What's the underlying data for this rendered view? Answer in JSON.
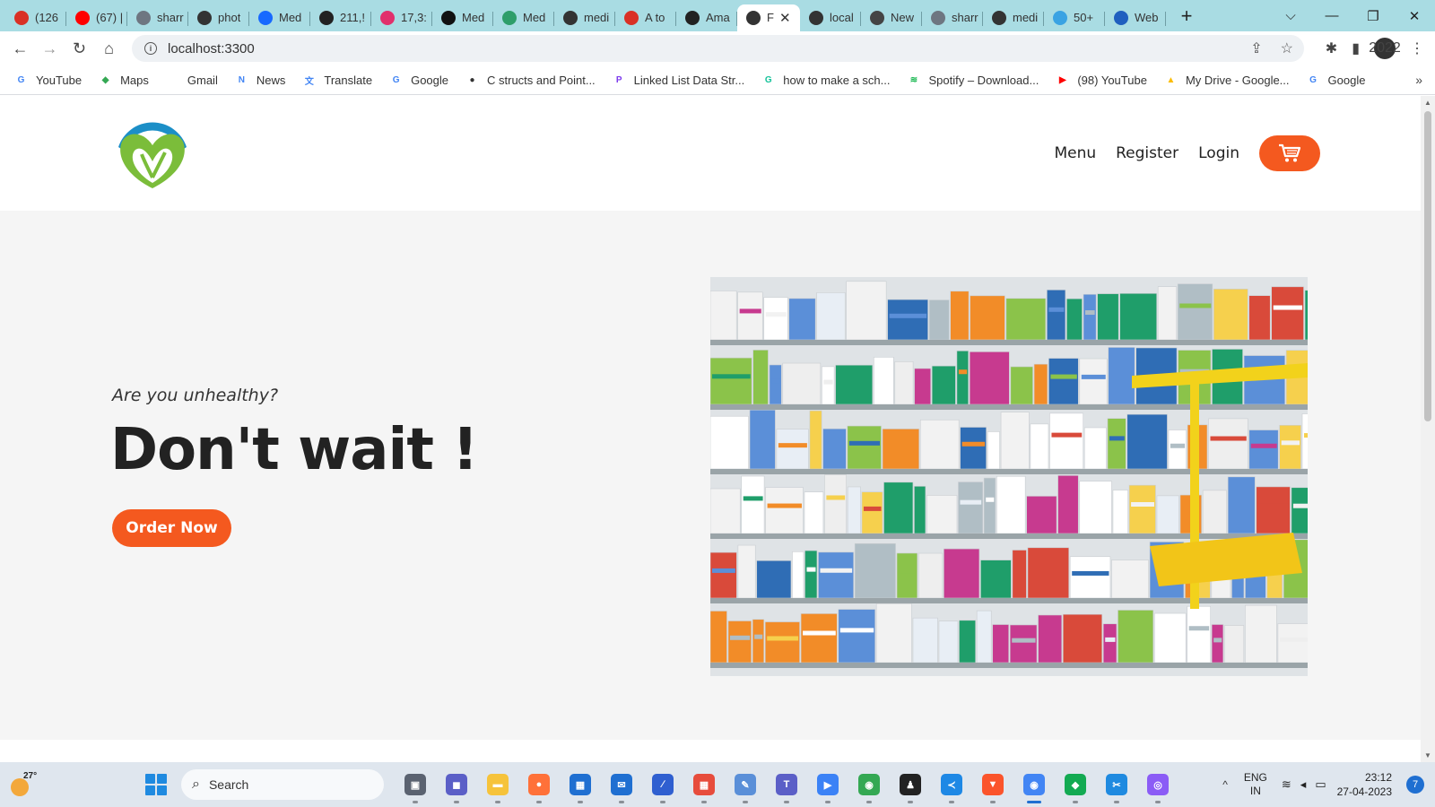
{
  "browser": {
    "tabs": [
      {
        "title": "(126",
        "icon": "gmail-icon",
        "color": "#d93025"
      },
      {
        "title": "(67) |",
        "icon": "youtube-icon",
        "color": "#ff0000"
      },
      {
        "title": "sharr",
        "icon": "github-icon",
        "color": "#6e7681"
      },
      {
        "title": "phot",
        "icon": "globe-icon",
        "color": "#333333"
      },
      {
        "title": "Med",
        "icon": "behance-icon",
        "color": "#1769ff"
      },
      {
        "title": "211,!",
        "icon": "shutterstock-icon",
        "color": "#222222"
      },
      {
        "title": "17,3:",
        "icon": "instagram-icon",
        "color": "#e1306c"
      },
      {
        "title": "Med",
        "icon": "stocksy-icon",
        "color": "#111111"
      },
      {
        "title": "Med",
        "icon": "document-icon",
        "color": "#2e9e6a"
      },
      {
        "title": "medi",
        "icon": "globe-icon",
        "color": "#333333"
      },
      {
        "title": "A to",
        "icon": "scribd-icon",
        "color": "#d93025"
      },
      {
        "title": "Ama",
        "icon": "amazon-icon",
        "color": "#222222"
      },
      {
        "title": "F",
        "icon": "globe-icon",
        "color": "#333333",
        "active": true
      },
      {
        "title": "local",
        "icon": "globe-icon",
        "color": "#333333"
      },
      {
        "title": "New",
        "icon": "chrome-icon",
        "color": "#444444"
      },
      {
        "title": "sharr",
        "icon": "github-icon",
        "color": "#6e7681"
      },
      {
        "title": "medi",
        "icon": "globe-icon",
        "color": "#333333"
      },
      {
        "title": "50+",
        "icon": "vectorgrove-icon",
        "color": "#3aa3e3"
      },
      {
        "title": "Web",
        "icon": "md-icon",
        "color": "#1f5fbf"
      }
    ],
    "new_tab": "+",
    "window_controls": {
      "dropdown": "⌵",
      "minimize": "—",
      "restore": "❐",
      "close": "✕"
    },
    "tab_close": "✕",
    "url": "localhost:3300",
    "nav": {
      "back": "←",
      "forward": "→",
      "reload": "↻",
      "home": "⌂"
    },
    "omnibox_icons": {
      "share": "⇪",
      "star": "☆"
    },
    "toolbar_icons": {
      "extensions": "✱",
      "sidepanel": "▮",
      "menu": "⋮"
    },
    "profile_label": "2022",
    "bookmarks": [
      {
        "label": "YouTube",
        "icon": "google-icon",
        "color": "#4285f4",
        "glyph": "G"
      },
      {
        "label": "Maps",
        "icon": "maps-icon",
        "color": "#34a853",
        "glyph": "◆"
      },
      {
        "label": "Gmail",
        "icon": "gmail-icon",
        "color": "#ffffff",
        "glyph": ""
      },
      {
        "label": "News",
        "icon": "news-icon",
        "color": "#4285f4",
        "glyph": "N"
      },
      {
        "label": "Translate",
        "icon": "translate-icon",
        "color": "#4285f4",
        "glyph": "文"
      },
      {
        "label": "Google",
        "icon": "google-icon",
        "color": "#4285f4",
        "glyph": "G"
      },
      {
        "label": "C structs and Point...",
        "icon": "globe-icon",
        "color": "#333333",
        "glyph": "●"
      },
      {
        "label": "Linked List Data Str...",
        "icon": "programiz-icon",
        "color": "#7c3aed",
        "glyph": "P"
      },
      {
        "label": "how to make a sch...",
        "icon": "grammarly-icon",
        "color": "#15c39a",
        "glyph": "G"
      },
      {
        "label": "Spotify – Download...",
        "icon": "spotify-icon",
        "color": "#1db954",
        "glyph": "≋"
      },
      {
        "label": "(98) YouTube",
        "icon": "youtube-icon",
        "color": "#ff0000",
        "glyph": "▶"
      },
      {
        "label": "My Drive - Google...",
        "icon": "drive-icon",
        "color": "#fbbc04",
        "glyph": "▲"
      },
      {
        "label": "Google",
        "icon": "google-icon",
        "color": "#4285f4",
        "glyph": "G"
      }
    ],
    "bookmarks_more": "»"
  },
  "site": {
    "nav": {
      "menu": "Menu",
      "register": "Register",
      "login": "Login"
    },
    "tagline": "Are you unhealthy?",
    "headline": "Don't wait !",
    "cta": "Order Now",
    "accent": "#f4591f",
    "logo_green": "#7bbd3a",
    "logo_blue": "#1c8fc7"
  },
  "taskbar": {
    "temperature": "27°",
    "search_label": "Search",
    "apps": [
      {
        "name": "task-view-icon",
        "color": "#5a6270",
        "glyph": "▣"
      },
      {
        "name": "meet-icon",
        "color": "#5b5fc7",
        "glyph": "◼"
      },
      {
        "name": "file-explorer-icon",
        "color": "#f6c33b",
        "glyph": "▬"
      },
      {
        "name": "firefox-icon",
        "color": "#ff7139",
        "glyph": "●"
      },
      {
        "name": "store-icon",
        "color": "#1f6fd1",
        "glyph": "▦"
      },
      {
        "name": "mail-icon",
        "color": "#1f6fd1",
        "glyph": "✉"
      },
      {
        "name": "mathpix-icon",
        "color": "#2f5fd0",
        "glyph": "∕"
      },
      {
        "name": "office-icon",
        "color": "#e74c3c",
        "glyph": "▦"
      },
      {
        "name": "notepad-icon",
        "color": "#5a8fd8",
        "glyph": "✎"
      },
      {
        "name": "teams-icon",
        "color": "#5b5fc7",
        "glyph": "T"
      },
      {
        "name": "power-automate-icon",
        "color": "#3b82f6",
        "glyph": "▶"
      },
      {
        "name": "chrome-icon",
        "color": "#34a853",
        "glyph": "◉"
      },
      {
        "name": "linux-icon",
        "color": "#222222",
        "glyph": "♟"
      },
      {
        "name": "vscode-icon",
        "color": "#1e88e5",
        "glyph": "≺"
      },
      {
        "name": "brave-icon",
        "color": "#fb542b",
        "glyph": "▼"
      },
      {
        "name": "chrome-profile-icon",
        "color": "#4285f4",
        "glyph": "◉",
        "active": true
      },
      {
        "name": "mongodb-compass-icon",
        "color": "#13aa52",
        "glyph": "◆"
      },
      {
        "name": "snipping-tool-icon",
        "color": "#1f8ae0",
        "glyph": "✂"
      },
      {
        "name": "github-desktop-icon",
        "color": "#8b5cf6",
        "glyph": "◎"
      }
    ],
    "lang_top": "ENG",
    "lang_bottom": "IN",
    "time": "23:12",
    "date": "27-04-2023",
    "notifications": "7"
  }
}
